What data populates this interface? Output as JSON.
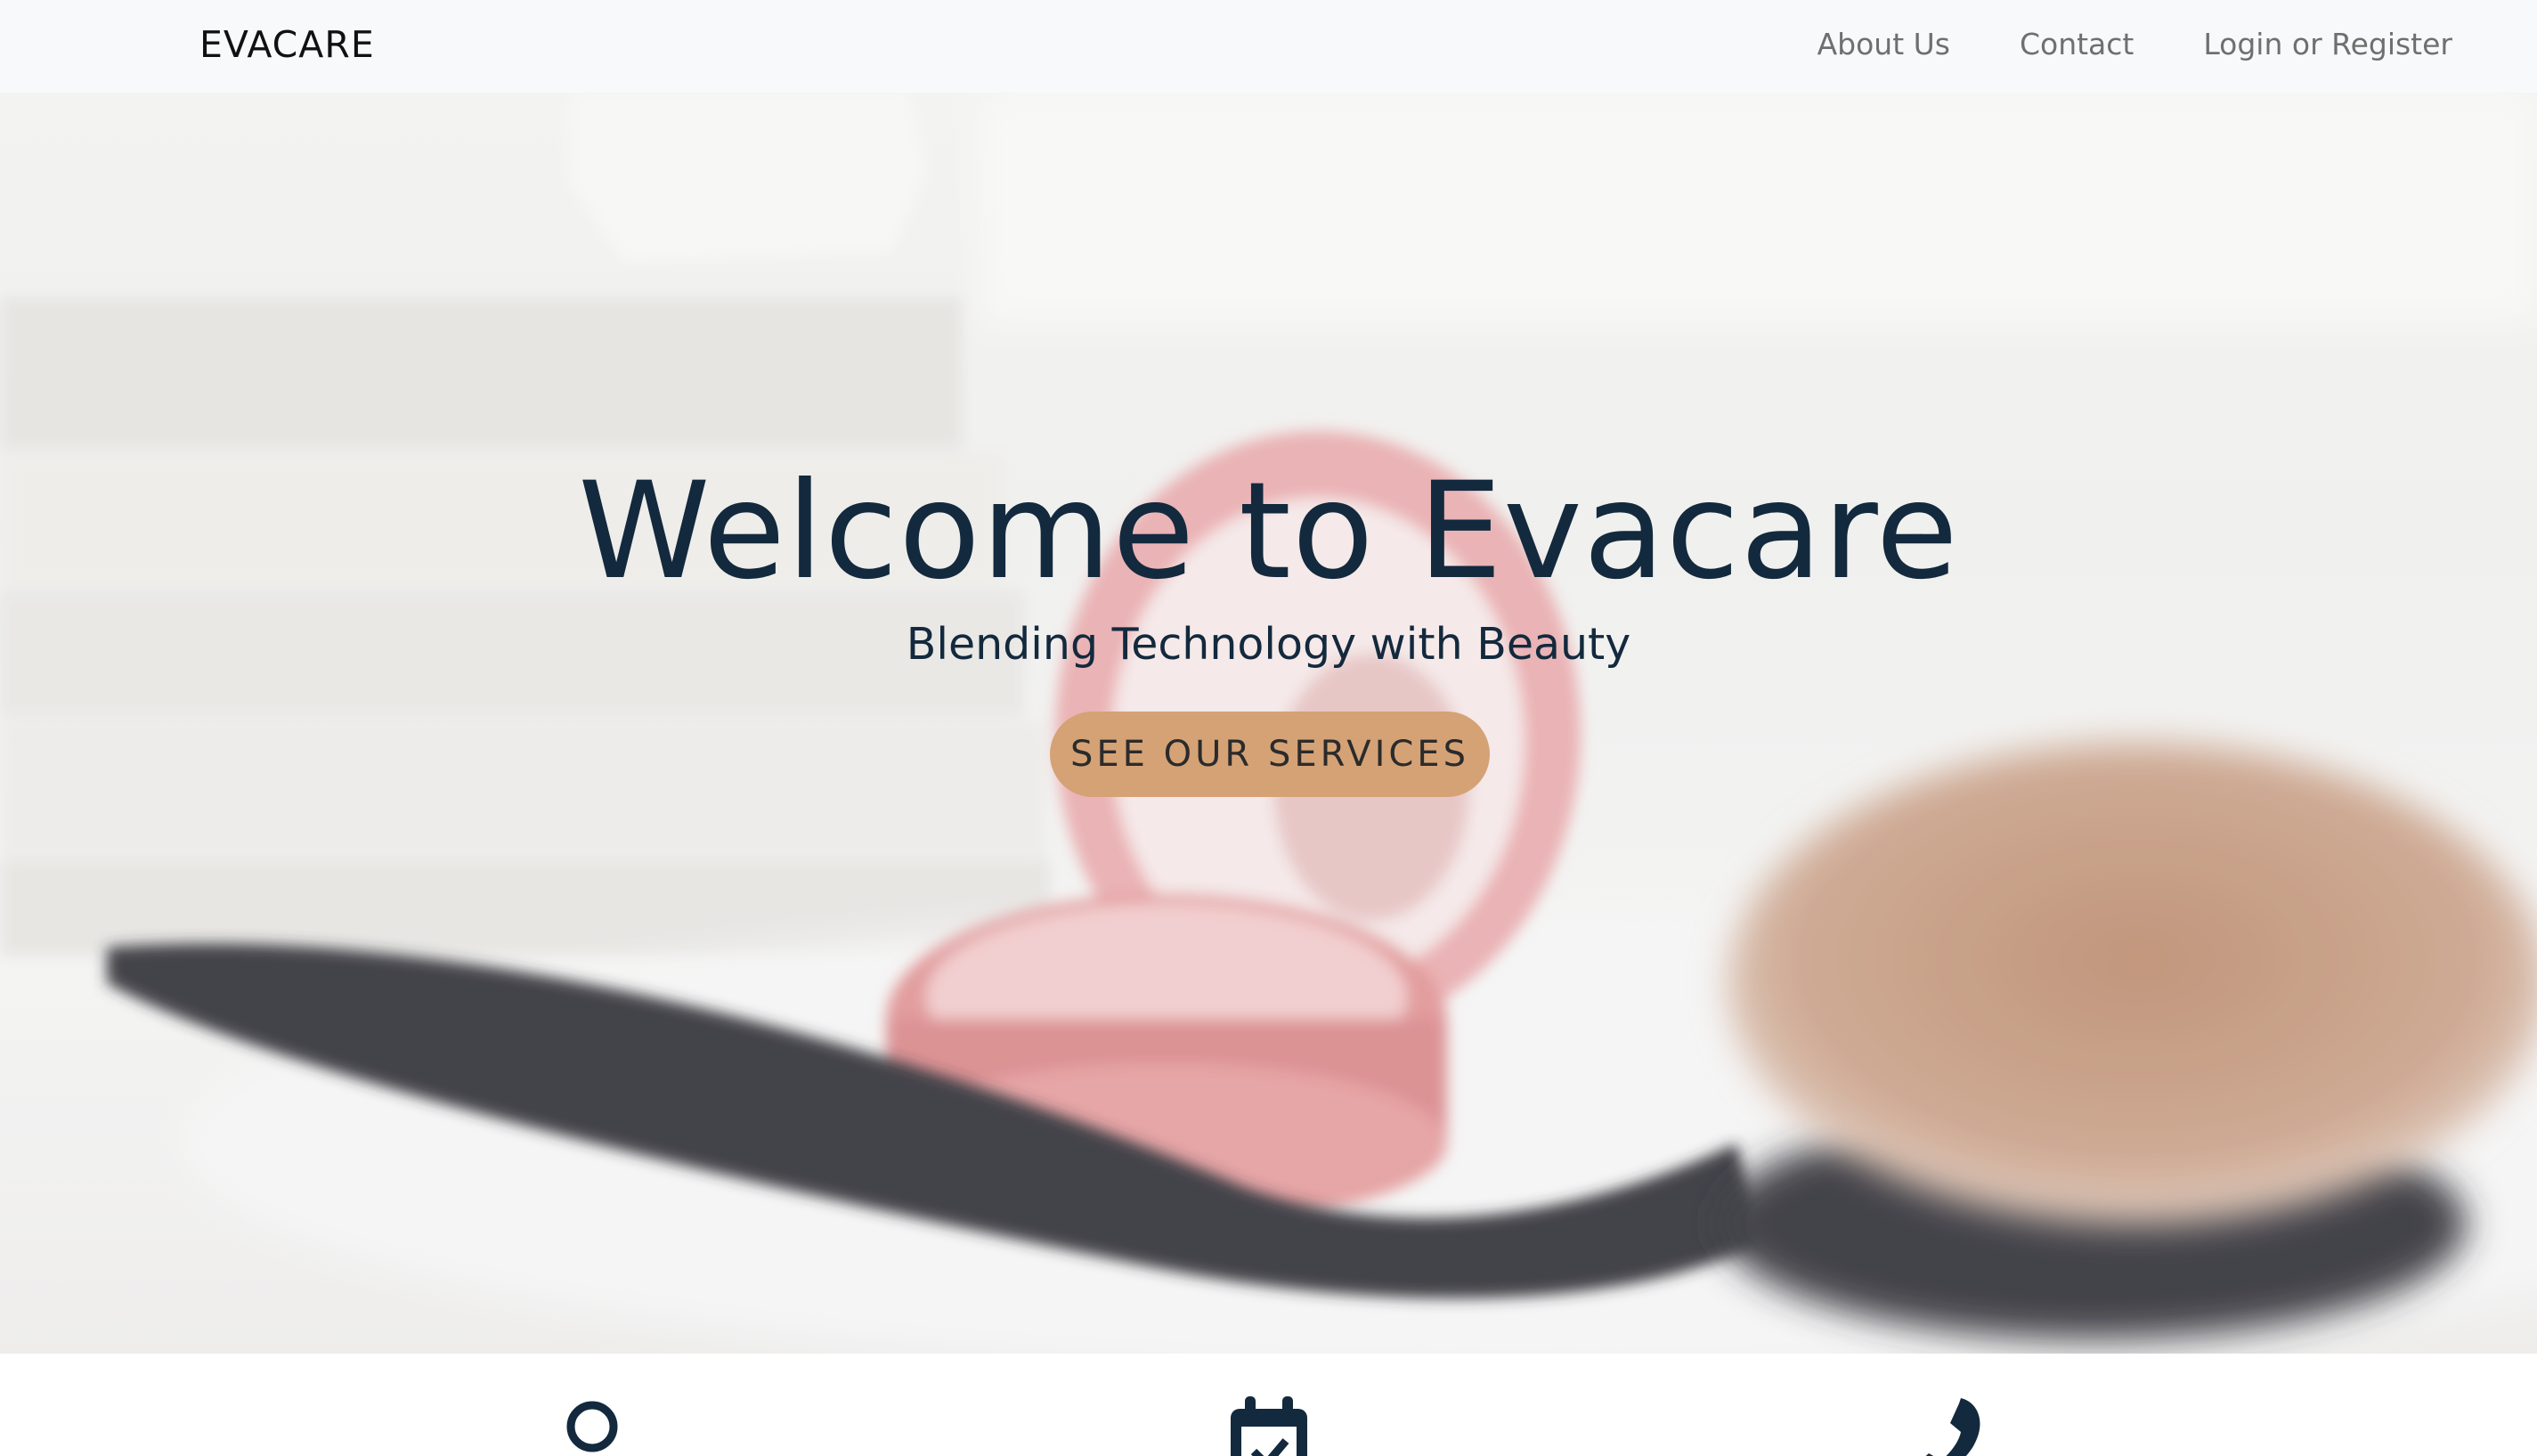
{
  "navbar": {
    "brand": "EVACARE",
    "links": [
      "About Us",
      "Contact",
      "Login or Register"
    ]
  },
  "hero": {
    "title": "Welcome to Evacare",
    "subtitle": "Blending Technology with Beauty",
    "cta_label": "SEE OUR SERVICES"
  },
  "services": {
    "icons": [
      "user-icon",
      "calendar-check-icon",
      "phone-icon"
    ]
  },
  "colors": {
    "navbar_bg": "#f8f9fa",
    "title_text": "#13293d",
    "cta_bg": "#d5a276",
    "icon_color": "#13293d"
  }
}
